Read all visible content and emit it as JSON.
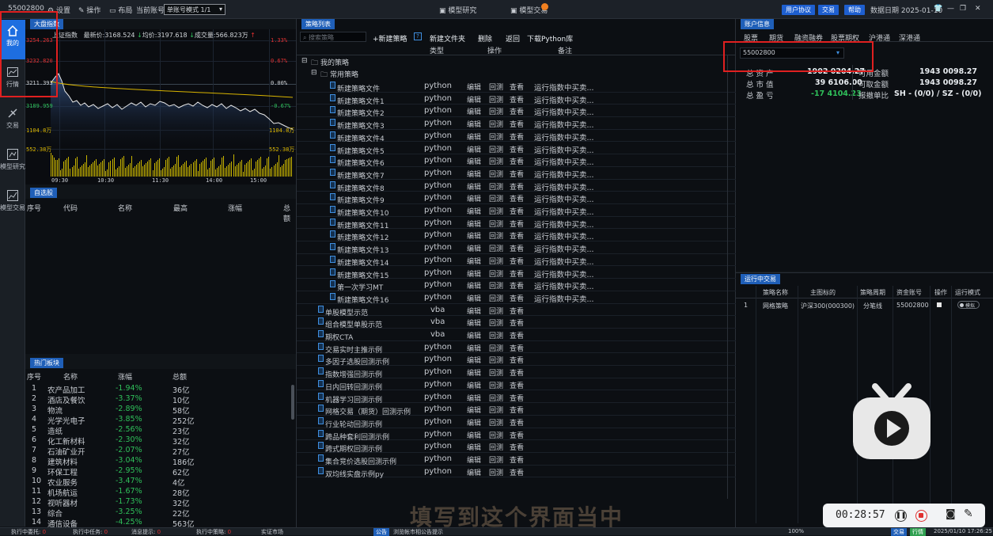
{
  "topbar": {
    "account": "55002800",
    "settings": "设置",
    "operate": "操作",
    "layout": "布局",
    "current_account_label": "当前账号",
    "mode_select": "单账号模式 1/1",
    "center_tab1": "模型研究",
    "center_tab2": "模型交易",
    "btn_user_agreement": "用户协议",
    "btn_trade": "交易",
    "btn_help": "帮助",
    "data_date": "数据日期 2025-01-10"
  },
  "leftnav": {
    "items": [
      {
        "label": "我的",
        "icon": "home-icon",
        "active": true
      },
      {
        "label": "行情",
        "icon": "chart-icon"
      },
      {
        "label": "交易",
        "icon": "trade-icon"
      },
      {
        "label": "模型研究",
        "icon": "research-icon"
      },
      {
        "label": "模型交易",
        "icon": "model-trade-icon"
      }
    ]
  },
  "market": {
    "tab": "大盘指数",
    "index_name": "上证指数",
    "latest_label": "最新价:",
    "latest": "3168.524",
    "avg_label": "均价:",
    "avg": "3197.618",
    "volume_label": "成交量:",
    "volume": "566.823万",
    "y_left": [
      "3254.263",
      "3232.820",
      "3211.393",
      "3189.959"
    ],
    "y_right": [
      "1.33%",
      "0.67%",
      "0.00%",
      "-0.67%"
    ],
    "vol_left": [
      "1104.8万",
      "552.38万"
    ],
    "vol_right": [
      "1104.8万",
      "552.38万"
    ],
    "x_times": [
      "09:30",
      "10:30",
      "11:30",
      "14:00",
      "15:00"
    ]
  },
  "watchlist": {
    "tab": "自选股",
    "headers": [
      "序号",
      "代码",
      "名称",
      "最高",
      "涨幅",
      "总额"
    ]
  },
  "hot_sectors": {
    "tab": "热门板块",
    "headers": [
      "序号",
      "名称",
      "涨幅",
      "总额"
    ],
    "rows": [
      {
        "no": "1",
        "name": "农产品加工",
        "change": "-1.94%",
        "amount": "36亿"
      },
      {
        "no": "2",
        "name": "酒店及餐饮",
        "change": "-3.37%",
        "amount": "10亿"
      },
      {
        "no": "3",
        "name": "物流",
        "change": "-2.89%",
        "amount": "58亿"
      },
      {
        "no": "4",
        "name": "光学光电子",
        "change": "-3.85%",
        "amount": "252亿"
      },
      {
        "no": "5",
        "name": "造纸",
        "change": "-2.56%",
        "amount": "23亿"
      },
      {
        "no": "6",
        "name": "化工新材料",
        "change": "-2.30%",
        "amount": "32亿"
      },
      {
        "no": "7",
        "name": "石油矿业开",
        "change": "-2.07%",
        "amount": "27亿"
      },
      {
        "no": "8",
        "name": "建筑材料",
        "change": "-3.04%",
        "amount": "186亿"
      },
      {
        "no": "9",
        "name": "环保工程",
        "change": "-2.95%",
        "amount": "62亿"
      },
      {
        "no": "10",
        "name": "农业服务",
        "change": "-3.47%",
        "amount": "4亿"
      },
      {
        "no": "11",
        "name": "机场航运",
        "change": "-1.67%",
        "amount": "28亿"
      },
      {
        "no": "12",
        "name": "视听器材",
        "change": "-1.73%",
        "amount": "32亿"
      },
      {
        "no": "13",
        "name": "综合",
        "change": "-3.25%",
        "amount": "22亿"
      },
      {
        "no": "14",
        "name": "通信设备",
        "change": "-4.25%",
        "amount": "563亿"
      }
    ]
  },
  "strategy": {
    "tab": "策略列表",
    "search_placeholder": "搜索策略",
    "new_strategy": "+新建策略",
    "new_folder": "新建文件夹",
    "delete": "删除",
    "back": "返回",
    "download_lib": "下载Python库",
    "col_type": "类型",
    "col_op": "操作",
    "col_note": "备注",
    "folder_my": "我的策略",
    "folder_common": "常用策略",
    "op_edit": "编辑",
    "op_backtest": "回测",
    "op_view": "查看",
    "note_text": "运行指数中买卖...",
    "rows": [
      {
        "name": "新建策略文件",
        "type": "python",
        "note": true,
        "indent": 2
      },
      {
        "name": "新建策略文件1",
        "type": "python",
        "note": true,
        "indent": 2
      },
      {
        "name": "新建策略文件2",
        "type": "python",
        "note": true,
        "indent": 2
      },
      {
        "name": "新建策略文件3",
        "type": "python",
        "note": true,
        "indent": 2
      },
      {
        "name": "新建策略文件4",
        "type": "python",
        "note": true,
        "indent": 2
      },
      {
        "name": "新建策略文件5",
        "type": "python",
        "note": true,
        "indent": 2
      },
      {
        "name": "新建策略文件6",
        "type": "python",
        "note": true,
        "indent": 2
      },
      {
        "name": "新建策略文件7",
        "type": "python",
        "note": true,
        "indent": 2
      },
      {
        "name": "新建策略文件8",
        "type": "python",
        "note": true,
        "indent": 2
      },
      {
        "name": "新建策略文件9",
        "type": "python",
        "note": true,
        "indent": 2
      },
      {
        "name": "新建策略文件10",
        "type": "python",
        "note": true,
        "indent": 2
      },
      {
        "name": "新建策略文件11",
        "type": "python",
        "note": true,
        "indent": 2
      },
      {
        "name": "新建策略文件12",
        "type": "python",
        "note": true,
        "indent": 2
      },
      {
        "name": "新建策略文件13",
        "type": "python",
        "note": true,
        "indent": 2
      },
      {
        "name": "新建策略文件14",
        "type": "python",
        "note": true,
        "indent": 2
      },
      {
        "name": "新建策略文件15",
        "type": "python",
        "note": true,
        "indent": 2
      },
      {
        "name": "第一次学习MT",
        "type": "python",
        "note": true,
        "indent": 2
      },
      {
        "name": "新建策略文件16",
        "type": "python",
        "note": true,
        "indent": 2
      },
      {
        "name": "单股模型示范",
        "type": "vba",
        "note": false,
        "indent": 1
      },
      {
        "name": "组合模型单股示范",
        "type": "vba",
        "note": false,
        "indent": 1
      },
      {
        "name": "期权CTA",
        "type": "vba",
        "note": false,
        "indent": 1
      },
      {
        "name": "交易实时主推示例",
        "type": "python",
        "note": false,
        "indent": 1
      },
      {
        "name": "多因子选股回测示例",
        "type": "python",
        "note": false,
        "indent": 1
      },
      {
        "name": "指数增强回测示例",
        "type": "python",
        "note": false,
        "indent": 1
      },
      {
        "name": "日内回转回测示例",
        "type": "python",
        "note": false,
        "indent": 1
      },
      {
        "name": "机器学习回测示例",
        "type": "python",
        "note": false,
        "indent": 1
      },
      {
        "name": "网格交易（期货）回测示例",
        "type": "python",
        "note": false,
        "indent": 1
      },
      {
        "name": "行业轮动回测示例",
        "type": "python",
        "note": false,
        "indent": 1
      },
      {
        "name": "跨品种套利回测示例",
        "type": "python",
        "note": false,
        "indent": 1
      },
      {
        "name": "跨式期权回测示例",
        "type": "python",
        "note": false,
        "indent": 1
      },
      {
        "name": "集合竞价选股回测示例",
        "type": "python",
        "note": false,
        "indent": 1
      },
      {
        "name": "双均线实盘示例py",
        "type": "python",
        "note": false,
        "indent": 1
      }
    ]
  },
  "account": {
    "tab": "账户信息",
    "subtabs": [
      "股票",
      "期货",
      "融资融券",
      "股票期权",
      "沪港通",
      "深港通"
    ],
    "account_select": "55002800",
    "total_assets_label": "总 资 产",
    "total_assets": "1902 0204.27",
    "market_value_label": "总 市 值",
    "market_value": "39 6106.00",
    "pnl_label": "总 盈 亏",
    "pnl": "-17 4104.23",
    "available_label": "可用金额",
    "available": "1943 0098.27",
    "withdrawable_label": "可取金额",
    "withdrawable": "1943 0098.27",
    "cancel_ratio_label": "报撤单比",
    "cancel_ratio": "SH - (0/0) / SZ - (0/0)"
  },
  "running": {
    "tab": "运行中交易",
    "headers": [
      "策略名称",
      "主图标的",
      "策略周期",
      "资金账号",
      "操作",
      "运行模式"
    ],
    "rows": [
      {
        "no": "1",
        "name": "网格策略",
        "target": "沪深300(000300)",
        "period": "分笔线",
        "account": "55002800",
        "mode": "模拟"
      }
    ]
  },
  "overlay": {
    "caption": "填写到这个界面当中",
    "timer": "00:28:57"
  },
  "statusbar": {
    "items": [
      "执行中委托:",
      "0",
      "执行中任务:",
      "0",
      "消息提示:",
      "0",
      "执行中策略:",
      "0",
      "实证市场",
      "公告",
      "浏览帐市相公告提示"
    ],
    "zoom": "100%",
    "btn_connect": "交易",
    "btn_quote": "行情",
    "datetime": "2025/01/10 17:26:25"
  },
  "colors": {
    "accent": "#1e6ee0",
    "down": "#2fc05a",
    "up": "#e03030",
    "yellow": "#d8b400"
  }
}
